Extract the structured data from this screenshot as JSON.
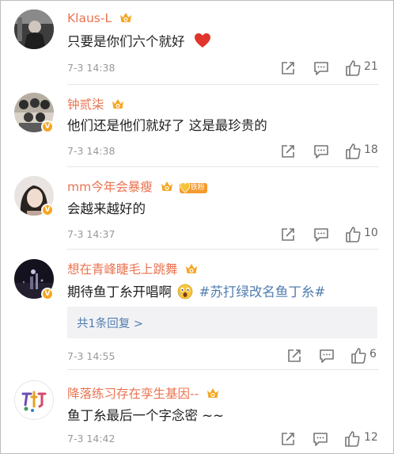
{
  "comments": [
    {
      "user": "Klaus-L",
      "text": "只要是你们六个就好",
      "time": "7-3 14:38",
      "likes": "21",
      "avatar_icon": "avatar-dark-silhouette",
      "verified": false
    },
    {
      "user": "钟贰柒",
      "text": "他们还是他们就好了 这是最珍贵的",
      "time": "7-3 14:38",
      "likes": "18",
      "avatar_icon": "avatar-group-photo",
      "verified": true
    },
    {
      "user": "mm今年会暴瘦",
      "fan_badge": "铁粉",
      "text": "会越来越好的",
      "time": "7-3 14:37",
      "likes": "10",
      "avatar_icon": "avatar-girl-photo",
      "verified": true
    },
    {
      "user": "想在青峰睫毛上跳舞",
      "text": "期待鱼丁糸开唱啊",
      "topic": "#苏打绿改名鱼丁糸#",
      "time": "7-3 14:55",
      "likes": "6",
      "reply_link": "共1条回复 >",
      "avatar_icon": "avatar-night-photo",
      "verified": true
    },
    {
      "user": "降落练习存在孪生基因--",
      "text": "鱼丁糸最后一个字念密 ~~",
      "time": "7-3 14:42",
      "likes": "12",
      "avatar_icon": "avatar-logo-illustration",
      "verified": false
    }
  ],
  "colors": {
    "username": "#eb7350",
    "topic": "#507daf",
    "crown": "#f5a623",
    "heart": "#e0352b"
  }
}
